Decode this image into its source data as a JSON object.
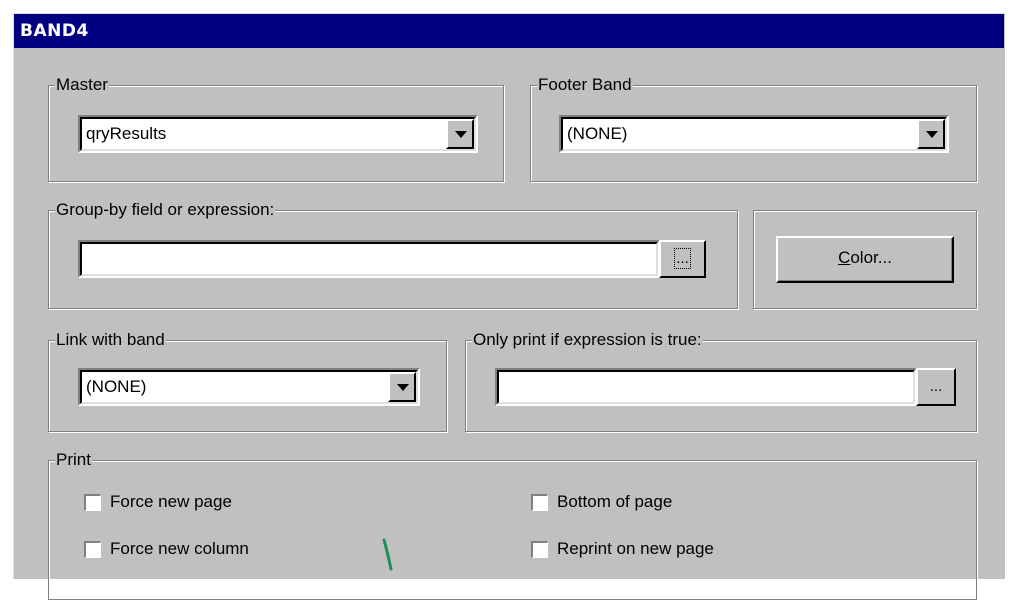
{
  "window": {
    "title": "BAND4"
  },
  "master": {
    "legend": "Master",
    "value": "qryResults"
  },
  "footer_band": {
    "legend": "Footer Band",
    "value": "(NONE)"
  },
  "group_by": {
    "legend": "Group-by field or expression:",
    "value": "",
    "ellipsis_label": "..."
  },
  "color_button": {
    "label_accel": "C",
    "label_rest": "olor..."
  },
  "link_band": {
    "legend": "Link with band",
    "value": "(NONE)"
  },
  "only_print": {
    "legend": "Only print if expression is true:",
    "value": "",
    "ellipsis_label": "..."
  },
  "print": {
    "legend": "Print",
    "options": [
      {
        "label": "Force new page",
        "checked": false
      },
      {
        "label": "Bottom of page",
        "checked": false
      },
      {
        "label": "Force new column",
        "checked": false
      },
      {
        "label": "Reprint on new page",
        "checked": false
      }
    ]
  },
  "colors": {
    "title_bar": "#000080",
    "face": "#c0c0c0",
    "annotation_stroke": "#1a8f5a"
  }
}
